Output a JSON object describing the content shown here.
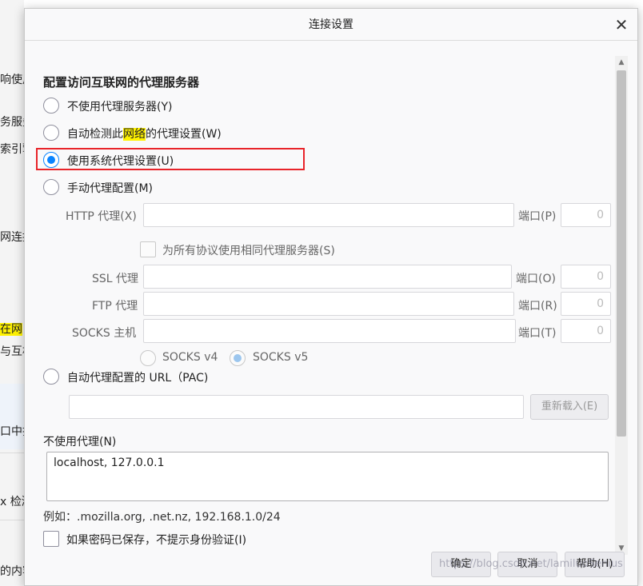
{
  "background": {
    "fragments": [
      "响使用",
      "务服务",
      "索引擎",
      "网连接",
      "在网",
      "与互相",
      "口中打",
      "x 检测",
      "的内容"
    ]
  },
  "dialog": {
    "title": "连接设置",
    "close_label": "✕"
  },
  "proxy": {
    "heading": "配置访问互联网的代理服务器",
    "options": [
      {
        "label": "不使用代理服务器(Y)",
        "checked": false
      },
      {
        "label_before": "自动检测此",
        "label_highlight": "网络",
        "label_after": "的代理设置(W)",
        "checked": false
      },
      {
        "label": "使用系统代理设置(U)",
        "checked": true
      },
      {
        "label": "手动代理配置(M)",
        "checked": false
      }
    ],
    "manual": {
      "http_label": "HTTP 代理(X)",
      "http_port_label": "端口(P)",
      "http_port_value": "0",
      "same_proxy_label": "为所有协议使用相同代理服务器(S)",
      "ssl_label": "SSL 代理",
      "ssl_port_label": "端口(O)",
      "ssl_port_value": "0",
      "ftp_label": "FTP 代理",
      "ftp_port_label": "端口(R)",
      "ftp_port_value": "0",
      "socks_label": "SOCKS 主机",
      "socks_port_label": "端口(T)",
      "socks_port_value": "0",
      "socks_v4_label": "SOCKS v4",
      "socks_v5_label": "SOCKS v5"
    },
    "pac": {
      "label": "自动代理配置的 URL（PAC)",
      "reload_label": "重新载入(E)"
    },
    "no_proxy": {
      "label": "不使用代理(N)",
      "value": "localhost, 127.0.0.1",
      "example": "例如：.mozilla.org, .net.nz, 192.168.1.0/24"
    },
    "no_auth_prompt_label": "如果密码已保存，不提示身份验证(I)"
  },
  "buttons": {
    "ok": "确定",
    "cancel": "取消",
    "help": "帮助(H)"
  },
  "watermark": "https://blog.csdn.net/lamiluoSenius",
  "colors": {
    "accent": "#0a84ff",
    "highlight_box": "#e8242a",
    "text_highlight": "#fff200"
  }
}
